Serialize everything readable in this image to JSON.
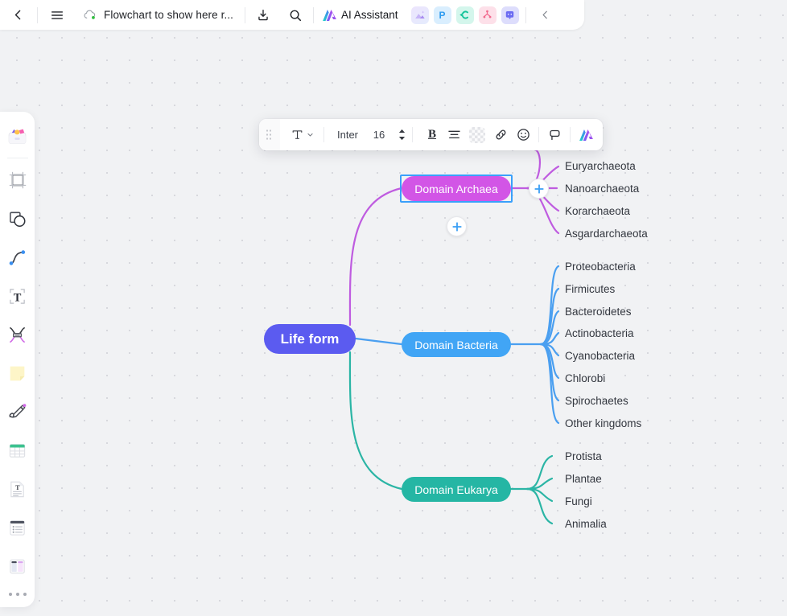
{
  "topbar": {
    "back_icon": "chevron-left-icon",
    "menu_icon": "hamburger-menu-icon",
    "cloud_icon": "cloud-saved-icon",
    "doc_title": "Flowchart to show here r...",
    "download_icon": "download-icon",
    "search_icon": "search-icon",
    "ai_assistant_label": "AI Assistant",
    "chips": [
      {
        "name": "image-app-chip",
        "label": ""
      },
      {
        "name": "presentation-app-chip",
        "label": "P"
      },
      {
        "name": "canva-app-chip",
        "label": "C"
      },
      {
        "name": "mindmap-app-chip",
        "label": ""
      },
      {
        "name": "chat-app-chip",
        "label": ""
      }
    ],
    "collapse_icon": "chevron-left-icon"
  },
  "sidebar": {
    "tools": [
      {
        "name": "template-library-tool",
        "label": "Templates"
      },
      {
        "name": "frame-tool",
        "label": "Frame"
      },
      {
        "name": "shape-tool",
        "label": "Shape"
      },
      {
        "name": "connector-tool",
        "label": "Connector"
      },
      {
        "name": "text-tool",
        "label": "Text"
      },
      {
        "name": "mindmap-tool",
        "label": "Mind map"
      },
      {
        "name": "sticky-note-tool",
        "label": "Sticky note"
      },
      {
        "name": "pen-tool",
        "label": "Pen"
      },
      {
        "name": "table-tool",
        "label": "Table"
      },
      {
        "name": "document-tool",
        "label": "Document"
      },
      {
        "name": "list-tool",
        "label": "List"
      },
      {
        "name": "kanban-tool",
        "label": "Kanban"
      }
    ],
    "more_label": "More tools"
  },
  "format_toolbar": {
    "grip": "drag-handle",
    "type_icon": "text-type-icon",
    "type_chevron": "chevron-down-icon",
    "font_family": "Inter",
    "font_size": "16",
    "stepper_up": "stepper-up-icon",
    "stepper_down": "stepper-down-icon",
    "bold_label": "B",
    "align_icon": "align-center-icon",
    "color_swatch_icon": "text-color-swatch",
    "link_icon": "link-icon",
    "emoji_icon": "emoji-icon",
    "comment_icon": "comment-icon",
    "ai_icon": "ai-sparkle-icon"
  },
  "mindmap": {
    "root": {
      "label": "Life form",
      "color": "#5b5bf0"
    },
    "branches": [
      {
        "label": "Domain Archaea",
        "color": "#d255e6",
        "selected": true,
        "children": [
          "Euryarchaeota",
          "Nanoarchaeota",
          "Korarchaeota",
          "Asgardarchaeota"
        ]
      },
      {
        "label": "Domain Bacteria",
        "color": "#41a5f5",
        "selected": false,
        "children": [
          "Proteobacteria",
          "Firmicutes",
          "Bacteroidetes",
          "Actinobacteria",
          "Cyanobacteria",
          "Chlorobi",
          "Spirochaetes",
          "Other kingdoms"
        ]
      },
      {
        "label": "Domain Eukarya",
        "color": "#25b6a4",
        "selected": false,
        "children": [
          "Protista",
          "Plantae",
          "Fungi",
          "Animalia"
        ]
      }
    ],
    "add_buttons": [
      {
        "name": "add-child-archaea-button",
        "label": "+"
      },
      {
        "name": "add-node-button",
        "label": "+"
      }
    ]
  }
}
